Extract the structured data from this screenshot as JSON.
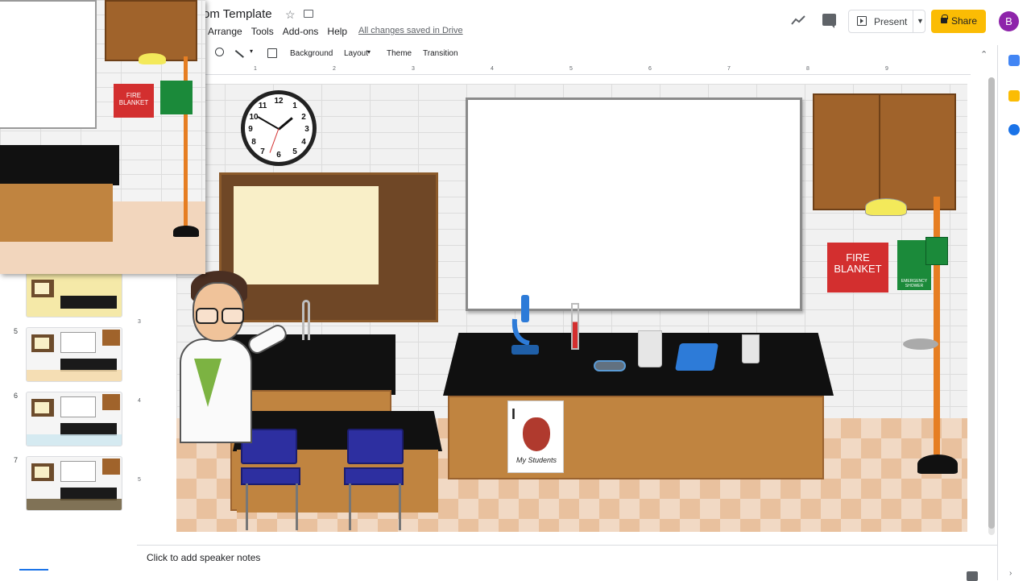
{
  "app": {
    "doc_title": "om Template",
    "saved_status": "All changes saved in Drive",
    "avatar_initial": "B",
    "accent_color": "#fbbc04"
  },
  "menu": [
    "Arrange",
    "Tools",
    "Add-ons",
    "Help"
  ],
  "header_actions": {
    "present_label": "Present",
    "share_label": "Share"
  },
  "toolbar": {
    "background": "Background",
    "layout": "Layout",
    "theme": "Theme",
    "transition": "Transition"
  },
  "ruler": {
    "horizontal": [
      "1",
      "2",
      "3",
      "4",
      "5",
      "6",
      "7",
      "8",
      "9"
    ],
    "vertical": [
      "3",
      "4",
      "5"
    ]
  },
  "filmstrip": {
    "slides": [
      {
        "number": "5",
        "floor_color": "#f5d9a8"
      },
      {
        "number": "6",
        "floor_color": "#cfe8f0"
      },
      {
        "number": "7",
        "floor_color": "#6b5a3a"
      }
    ]
  },
  "slide": {
    "fire_sign": "FIRE BLANKET",
    "shower_sign": "EMERGENCY SHOWER",
    "poster_letter": "I",
    "poster_caption": "My Students",
    "clock_numbers": [
      "12",
      "1",
      "2",
      "3",
      "4",
      "5",
      "6",
      "7",
      "8",
      "9",
      "10",
      "11"
    ]
  },
  "preview_card": {
    "fire_sign": "FIRE BLANKET"
  },
  "notes": {
    "placeholder": "Click to add speaker notes"
  }
}
